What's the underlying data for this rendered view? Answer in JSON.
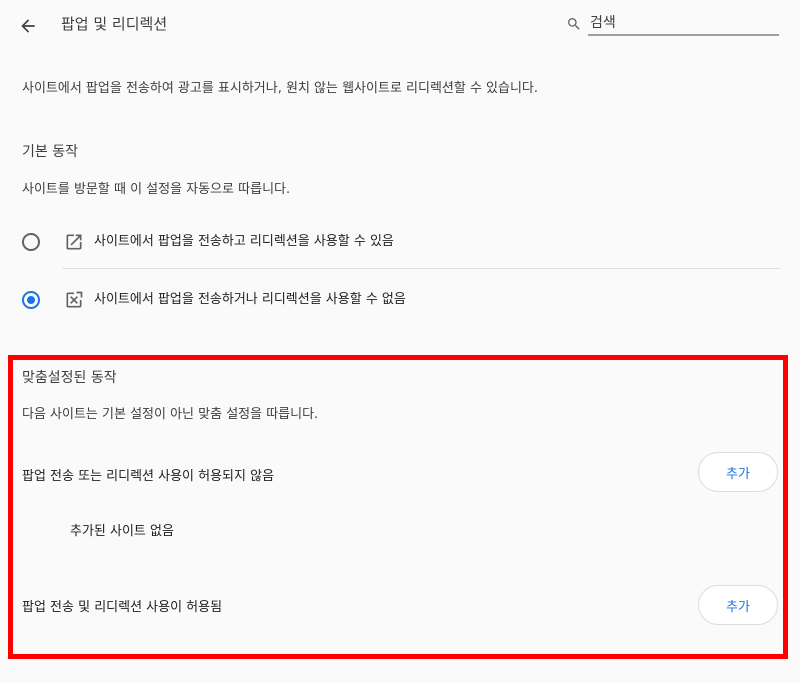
{
  "header": {
    "title": "팝업 및 리디렉션",
    "search_placeholder": "검색",
    "back_icon": "arrow-back-icon",
    "search_icon": "search-icon"
  },
  "description": "사이트에서 팝업을 전송하여 광고를 표시하거나, 원치 않는 웹사이트로 리디렉션할 수 있습니다.",
  "default_behavior": {
    "heading": "기본 동작",
    "subtitle": "사이트를 방문할 때 이 설정을 자동으로 따릅니다.",
    "options": [
      {
        "label": "사이트에서 팝업을 전송하고 리디렉션을 사용할 수 있음",
        "icon": "open-in-new-icon",
        "selected": false
      },
      {
        "label": "사이트에서 팝업을 전송하거나 리디렉션을 사용할 수 없음",
        "icon": "popup-blocked-icon",
        "selected": true
      }
    ]
  },
  "custom_behavior": {
    "heading": "맞춤설정된 동작",
    "subtitle": "다음 사이트는 기본 설정이 아닌 맞춤 설정을 따릅니다.",
    "blocked_label": "팝업 전송 또는 리디렉션 사용이 허용되지 않음",
    "blocked_empty": "추가된 사이트 없음",
    "allowed_label": "팝업 전송 및 리디렉션 사용이 허용됨",
    "add_label": "추가"
  },
  "colors": {
    "accent": "#1a73e8",
    "highlight": "#ff0000"
  }
}
